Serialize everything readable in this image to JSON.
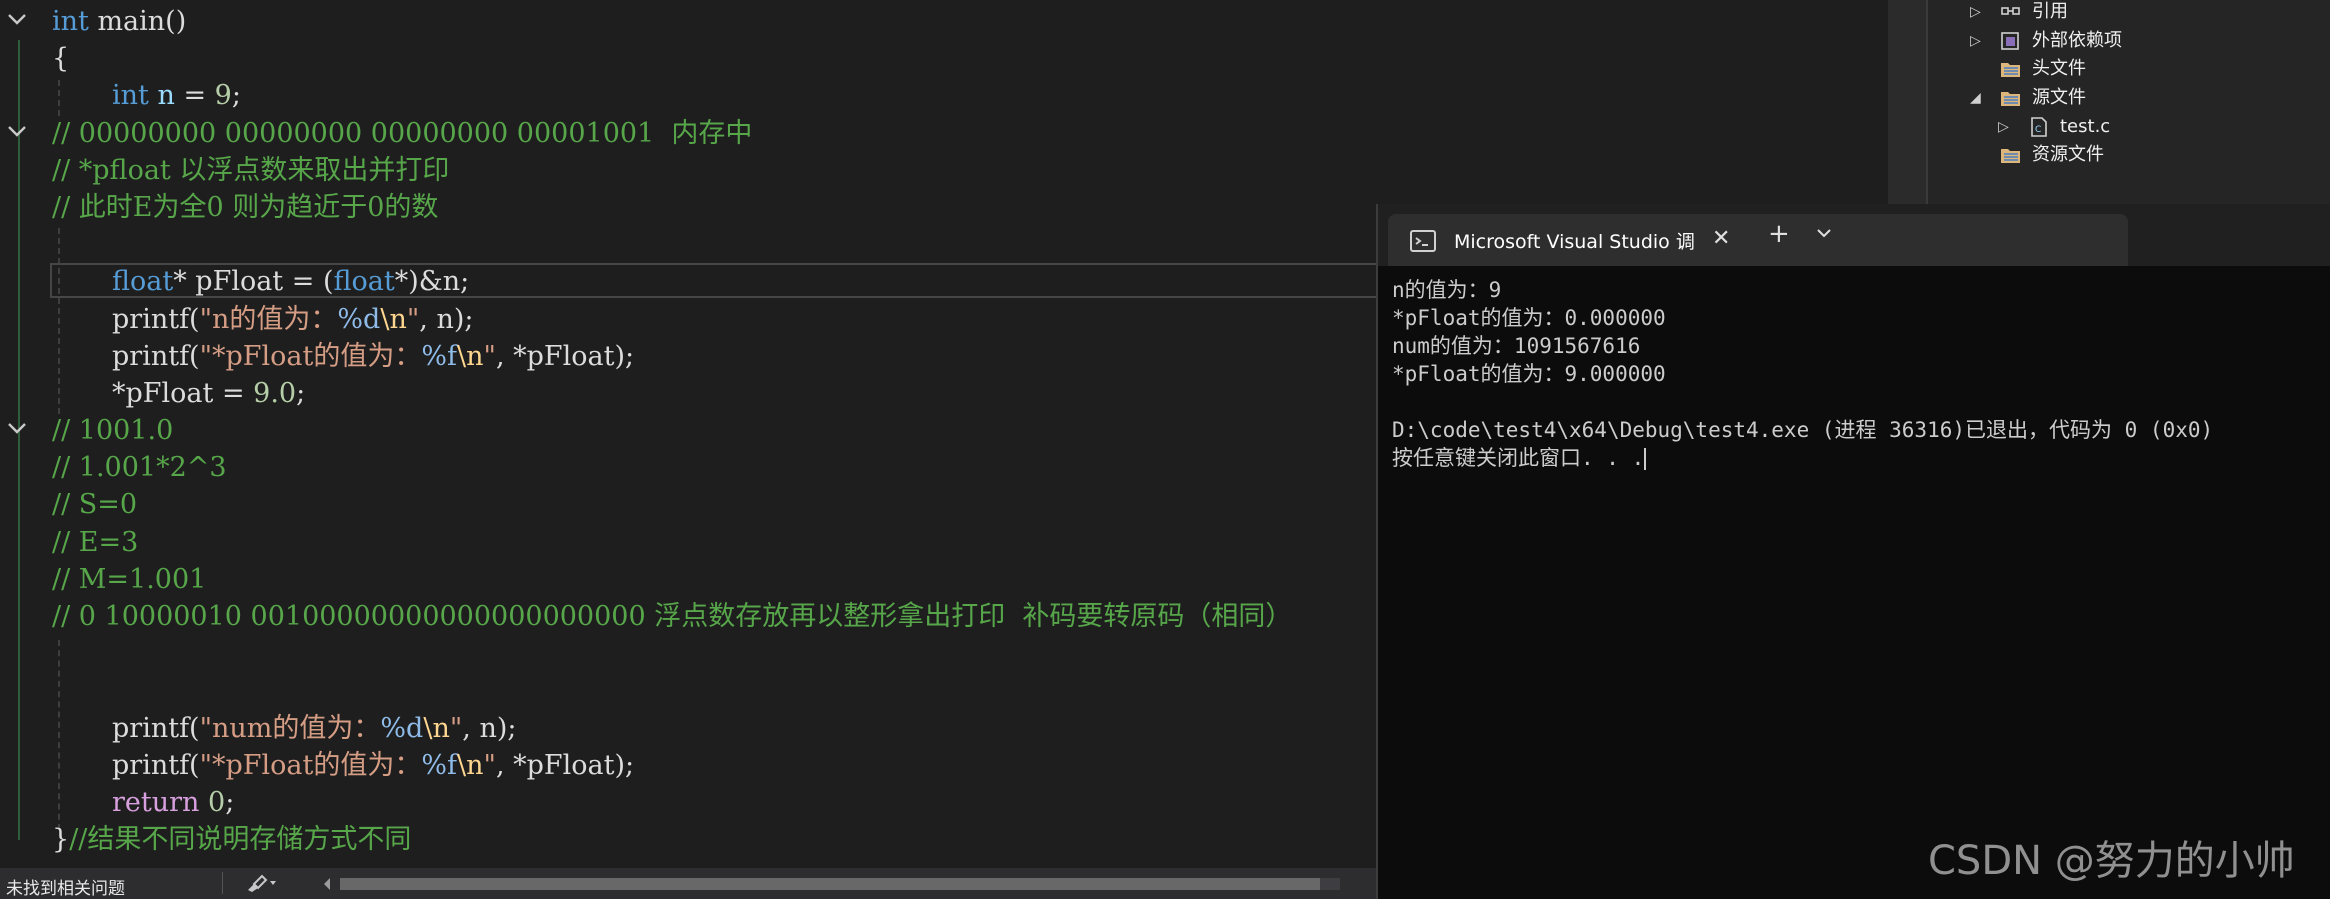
{
  "editor": {
    "lines": [
      {
        "fold": "expanded",
        "indent": false,
        "tokens": [
          {
            "c": "kw",
            "t": "int"
          },
          {
            "c": "plain",
            "t": " main()"
          }
        ]
      },
      {
        "fold": "",
        "indent": false,
        "tokens": [
          {
            "c": "plain",
            "t": "{"
          }
        ]
      },
      {
        "fold": "",
        "indent": true,
        "tokens": [
          {
            "c": "kw",
            "t": "int"
          },
          {
            "c": "plain",
            "t": " "
          },
          {
            "c": "var",
            "t": "n"
          },
          {
            "c": "plain",
            "t": " = "
          },
          {
            "c": "num",
            "t": "9"
          },
          {
            "c": "plain",
            "t": ";"
          }
        ]
      },
      {
        "fold": "expanded",
        "indent": false,
        "tokens": [
          {
            "c": "cm",
            "t": "// 00000000 00000000 00000000 00001001  内存中"
          }
        ]
      },
      {
        "fold": "",
        "indent": false,
        "tokens": [
          {
            "c": "cm",
            "t": "// *pfloat 以浮点数来取出并打印"
          }
        ]
      },
      {
        "fold": "",
        "indent": false,
        "tokens": [
          {
            "c": "cm",
            "t": "// 此时E为全0 则为趋近于0的数"
          }
        ]
      },
      {
        "fold": "",
        "indent": false,
        "tokens": []
      },
      {
        "fold": "",
        "indent": true,
        "current": true,
        "tokens": [
          {
            "c": "kw",
            "t": "float"
          },
          {
            "c": "plain",
            "t": "* pFloat = ("
          },
          {
            "c": "kw",
            "t": "float"
          },
          {
            "c": "plain",
            "t": "*)&n;"
          }
        ]
      },
      {
        "fold": "",
        "indent": true,
        "tokens": [
          {
            "c": "plain",
            "t": "printf("
          },
          {
            "c": "str",
            "t": "\"n的值为："
          },
          {
            "c": "fmt",
            "t": "%d"
          },
          {
            "c": "esc",
            "t": "\\n"
          },
          {
            "c": "str",
            "t": "\""
          },
          {
            "c": "plain",
            "t": ", n);"
          }
        ]
      },
      {
        "fold": "",
        "indent": true,
        "tokens": [
          {
            "c": "plain",
            "t": "printf("
          },
          {
            "c": "str",
            "t": "\"*pFloat的值为："
          },
          {
            "c": "fmt",
            "t": "%f"
          },
          {
            "c": "esc",
            "t": "\\n"
          },
          {
            "c": "str",
            "t": "\""
          },
          {
            "c": "plain",
            "t": ", *pFloat);"
          }
        ]
      },
      {
        "fold": "",
        "indent": true,
        "tokens": [
          {
            "c": "plain",
            "t": "*pFloat = "
          },
          {
            "c": "num",
            "t": "9.0"
          },
          {
            "c": "plain",
            "t": ";"
          }
        ]
      },
      {
        "fold": "expanded",
        "indent": false,
        "tokens": [
          {
            "c": "cm",
            "t": "// 1001.0"
          }
        ]
      },
      {
        "fold": "",
        "indent": false,
        "tokens": [
          {
            "c": "cm",
            "t": "// 1.001*2^3"
          }
        ]
      },
      {
        "fold": "",
        "indent": false,
        "tokens": [
          {
            "c": "cm",
            "t": "// S=0"
          }
        ]
      },
      {
        "fold": "",
        "indent": false,
        "tokens": [
          {
            "c": "cm",
            "t": "// E=3"
          }
        ]
      },
      {
        "fold": "",
        "indent": false,
        "tokens": [
          {
            "c": "cm",
            "t": "// M=1.001"
          }
        ]
      },
      {
        "fold": "",
        "indent": false,
        "tokens": [
          {
            "c": "cm",
            "t": "// 0 10000010 00100000000000000000000 浮点数存放再以整形拿出打印  补码要转原码（相同）"
          }
        ]
      },
      {
        "fold": "",
        "indent": false,
        "tokens": []
      },
      {
        "fold": "",
        "indent": false,
        "tokens": []
      },
      {
        "fold": "",
        "indent": true,
        "tokens": [
          {
            "c": "plain",
            "t": "printf("
          },
          {
            "c": "str",
            "t": "\"num的值为："
          },
          {
            "c": "fmt",
            "t": "%d"
          },
          {
            "c": "esc",
            "t": "\\n"
          },
          {
            "c": "str",
            "t": "\""
          },
          {
            "c": "plain",
            "t": ", n);"
          }
        ]
      },
      {
        "fold": "",
        "indent": true,
        "tokens": [
          {
            "c": "plain",
            "t": "printf("
          },
          {
            "c": "str",
            "t": "\"*pFloat的值为："
          },
          {
            "c": "fmt",
            "t": "%f"
          },
          {
            "c": "esc",
            "t": "\\n"
          },
          {
            "c": "str",
            "t": "\""
          },
          {
            "c": "plain",
            "t": ", *pFloat);"
          }
        ]
      },
      {
        "fold": "",
        "indent": true,
        "tokens": [
          {
            "c": "kw2",
            "t": "return"
          },
          {
            "c": "plain",
            "t": " "
          },
          {
            "c": "num",
            "t": "0"
          },
          {
            "c": "plain",
            "t": ";"
          }
        ]
      },
      {
        "fold": "",
        "indent": false,
        "tokens": [
          {
            "c": "plain",
            "t": "}"
          },
          {
            "c": "cm",
            "t": "//结果不同说明存储方式不同"
          }
        ]
      }
    ]
  },
  "status_bar": {
    "message": "未找到相关问题",
    "icons": [
      "brush-icon",
      "scroll-left-icon"
    ]
  },
  "solution_explorer": {
    "items": [
      {
        "name": "references",
        "label": "引用",
        "icon": "references-icon",
        "arrow": "collapsed"
      },
      {
        "name": "external-deps",
        "label": "外部依赖项",
        "icon": "external-deps-icon",
        "arrow": "collapsed"
      },
      {
        "name": "header-files",
        "label": "头文件",
        "icon": "folder-icon",
        "arrow": ""
      },
      {
        "name": "source-files",
        "label": "源文件",
        "icon": "folder-icon",
        "arrow": "expanded"
      },
      {
        "name": "test-c",
        "label": "test.c",
        "icon": "c-file-icon",
        "arrow": "collapsed"
      },
      {
        "name": "resource-files",
        "label": "资源文件",
        "icon": "folder-icon",
        "arrow": ""
      }
    ]
  },
  "console": {
    "tab_title": "Microsoft Visual Studio 调试控制台",
    "icons": [
      "terminal-icon",
      "close-icon",
      "plus-icon",
      "chevron-down-icon"
    ],
    "output": [
      "n的值为：9",
      "*pFloat的值为：0.000000",
      "num的值为：1091567616",
      "*pFloat的值为：9.000000",
      "",
      "D:\\code\\test4\\x64\\Debug\\test4.exe (进程 36316)已退出，代码为 0 (0x0)",
      "按任意键关闭此窗口. . ."
    ]
  },
  "watermark": "CSDN @努力的小帅"
}
